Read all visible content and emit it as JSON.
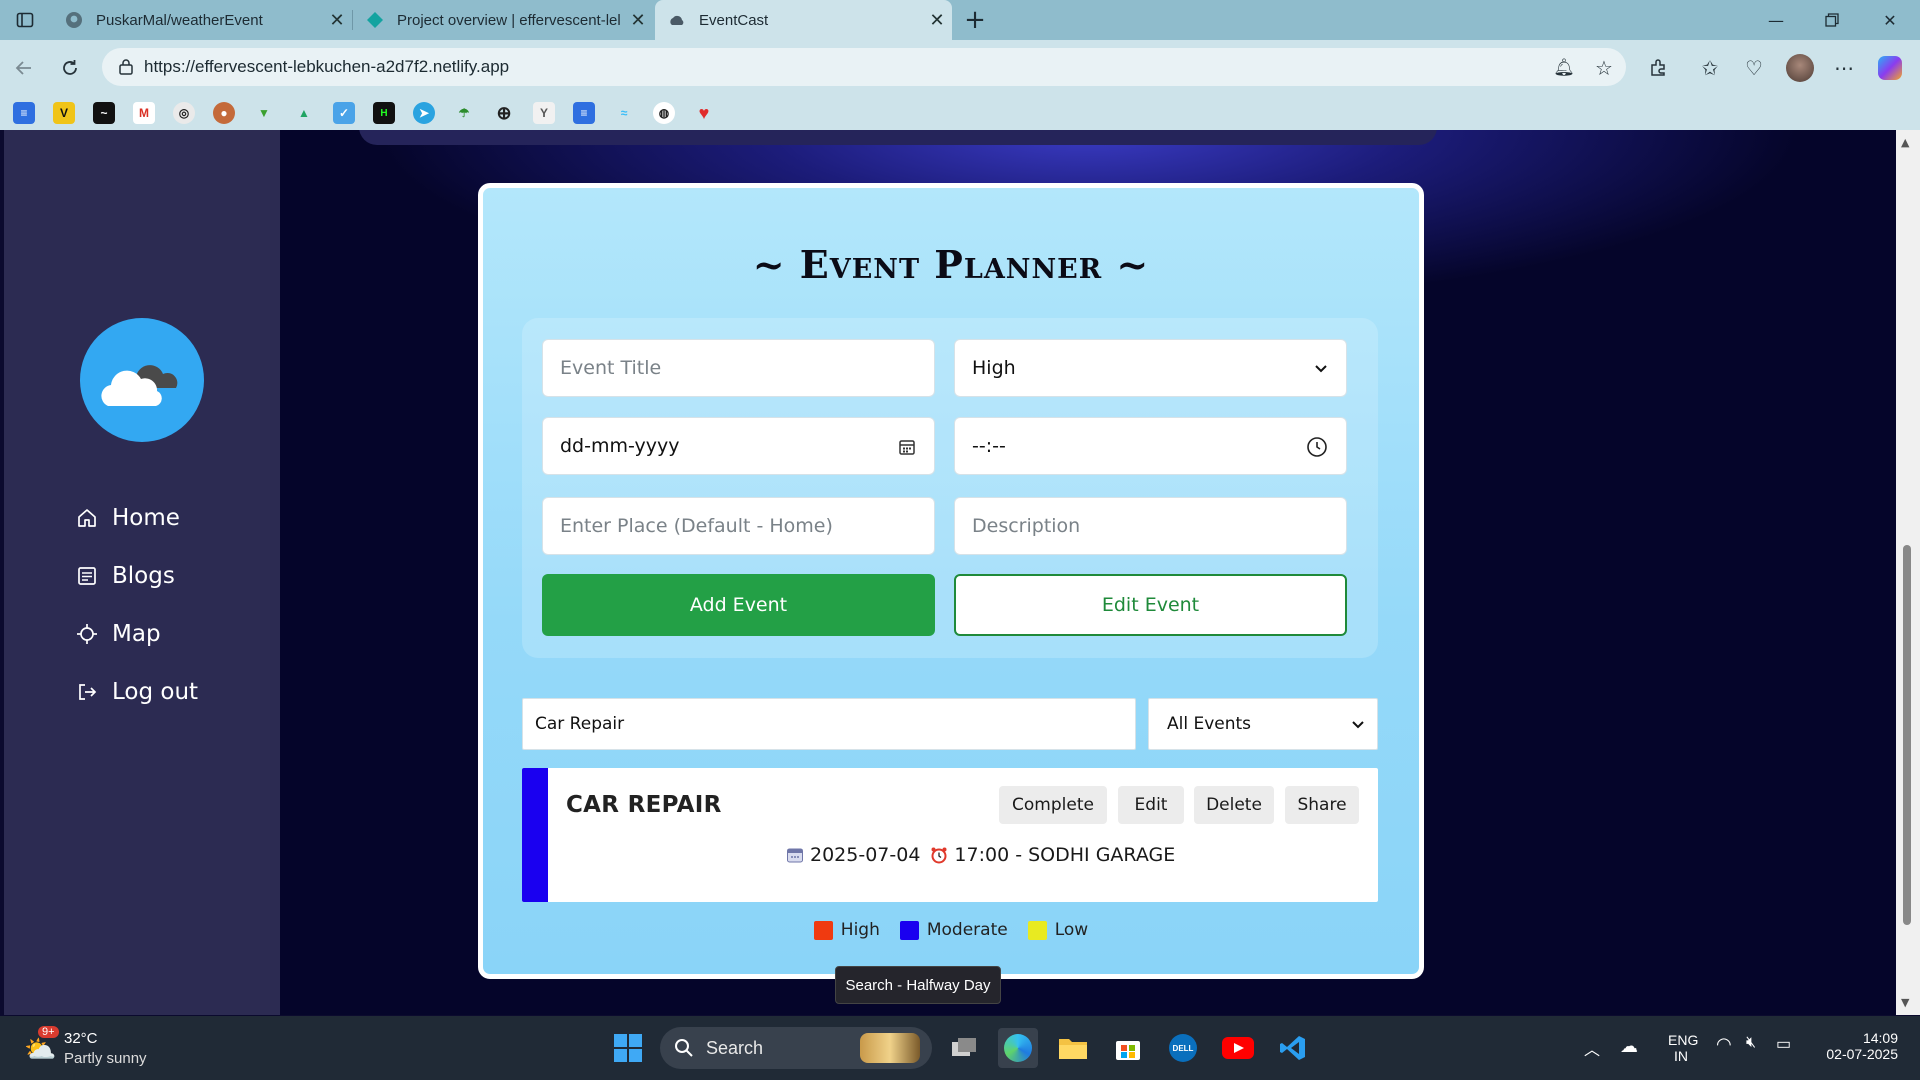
{
  "browser": {
    "tabs": [
      {
        "label": "PuskarMal/weatherEvent",
        "icon": "github-icon"
      },
      {
        "label": "Project overview | effervescent-lel",
        "icon": "netlify-icon"
      },
      {
        "label": "EventCast",
        "icon": "app-icon",
        "active": true
      }
    ],
    "url": "https://effervescent-lebkuchen-a2d7f2.netlify.app"
  },
  "sidebar": {
    "items": [
      {
        "label": "Home",
        "icon": "home-icon"
      },
      {
        "label": "Blogs",
        "icon": "blogs-icon"
      },
      {
        "label": "Map",
        "icon": "map-icon"
      },
      {
        "label": "Log out",
        "icon": "logout-icon"
      }
    ]
  },
  "planner": {
    "title": "~ Event Planner ~",
    "event_title_placeholder": "Event Title",
    "priority_value": "High",
    "date_placeholder": "dd-mm-yyyy",
    "time_placeholder": "--:--",
    "place_placeholder": "Enter Place (Default - Home)",
    "description_placeholder": "Description",
    "add_label": "Add Event",
    "edit_label": "Edit Event"
  },
  "filter": {
    "search_value": "Car Repair",
    "select_value": "All Events"
  },
  "events": [
    {
      "title": "CAR REPAIR",
      "date": "2025-07-04",
      "time_place": "17:00 - SODHI GARAGE",
      "priority_color": "#1a00f0",
      "actions": [
        "Complete",
        "Edit",
        "Delete",
        "Share"
      ]
    }
  ],
  "legend": [
    {
      "label": "High",
      "color": "#f03a10"
    },
    {
      "label": "Moderate",
      "color": "#1a00f0"
    },
    {
      "label": "Low",
      "color": "#e8ea21"
    }
  ],
  "tooltip": "Search - Halfway Day",
  "taskbar": {
    "weather_temp": "32°C",
    "weather_desc": "Partly sunny",
    "weather_badge": "9+",
    "search_label": "Search",
    "lang_1": "ENG",
    "lang_2": "IN",
    "time": "14:09",
    "date": "02-07-2025"
  }
}
